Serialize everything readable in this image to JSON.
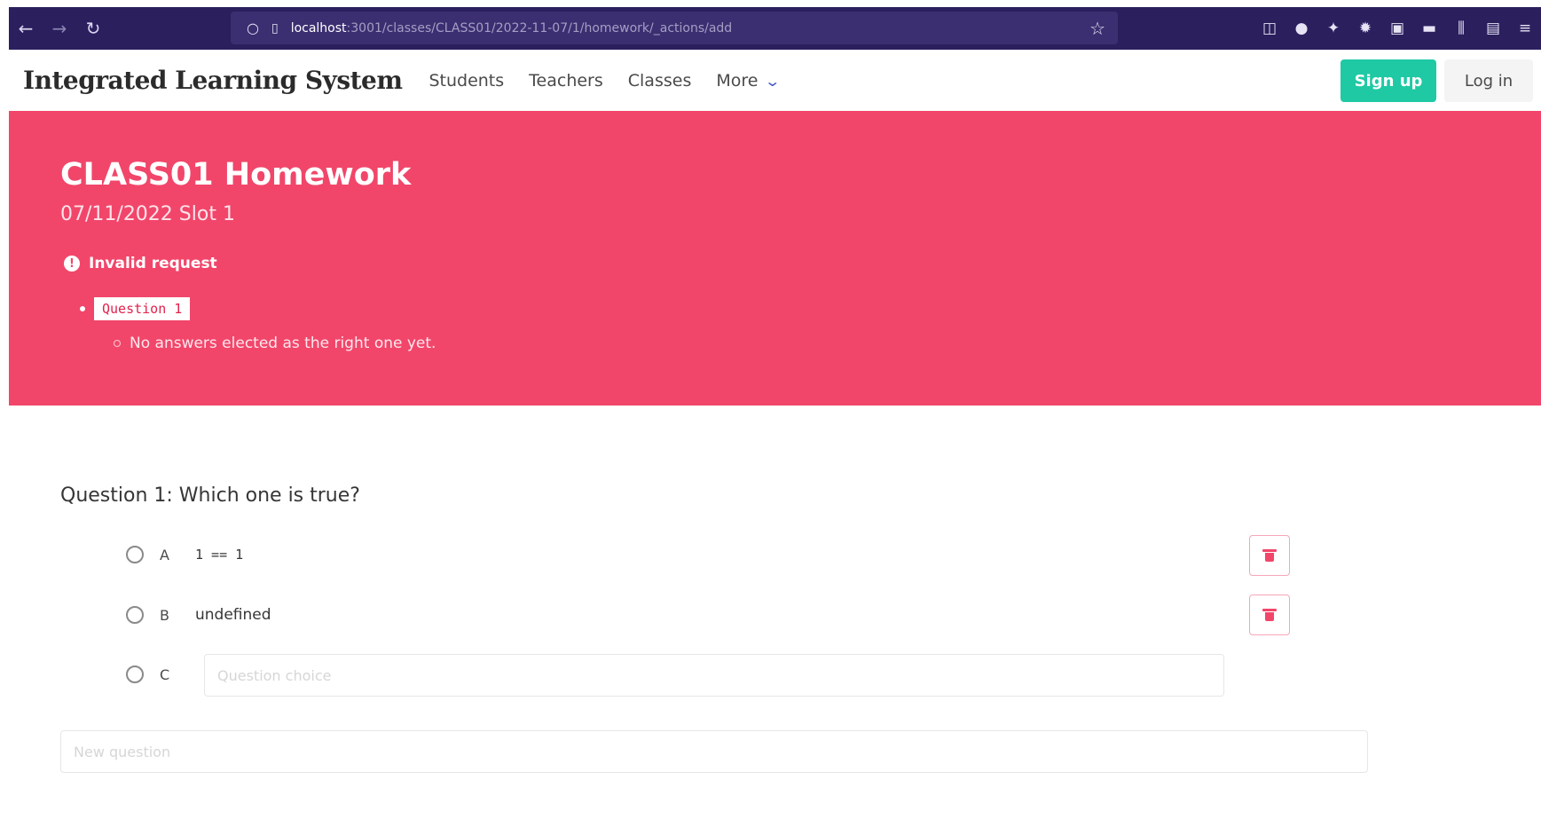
{
  "browser": {
    "url_host": "localhost",
    "url_path": ":3001/classes/CLASS01/2022-11-07/1/homework/_actions/add"
  },
  "navbar": {
    "brand": "Integrated Learning System",
    "items": [
      {
        "label": "Students"
      },
      {
        "label": "Teachers"
      },
      {
        "label": "Classes"
      },
      {
        "label": "More"
      }
    ],
    "signup": "Sign up",
    "login": "Log in"
  },
  "hero": {
    "title": "CLASS01 Homework",
    "subtitle": "07/11/2022 Slot 1",
    "error_title": "Invalid request",
    "error_field": "Question 1",
    "error_message": "No answers elected as the right one yet."
  },
  "question": {
    "title": "Question 1: Which one is true?",
    "choices": [
      {
        "letter": "A",
        "text": "1 == 1"
      },
      {
        "letter": "B",
        "text": "undefined"
      }
    ],
    "new_choice_letter": "C",
    "new_choice_placeholder": "Question choice"
  },
  "new_question_placeholder": "New question",
  "colors": {
    "hero_bg": "#f1466a",
    "signup_bg": "#1fc9a4",
    "browser_bg": "#2b1f5e"
  }
}
